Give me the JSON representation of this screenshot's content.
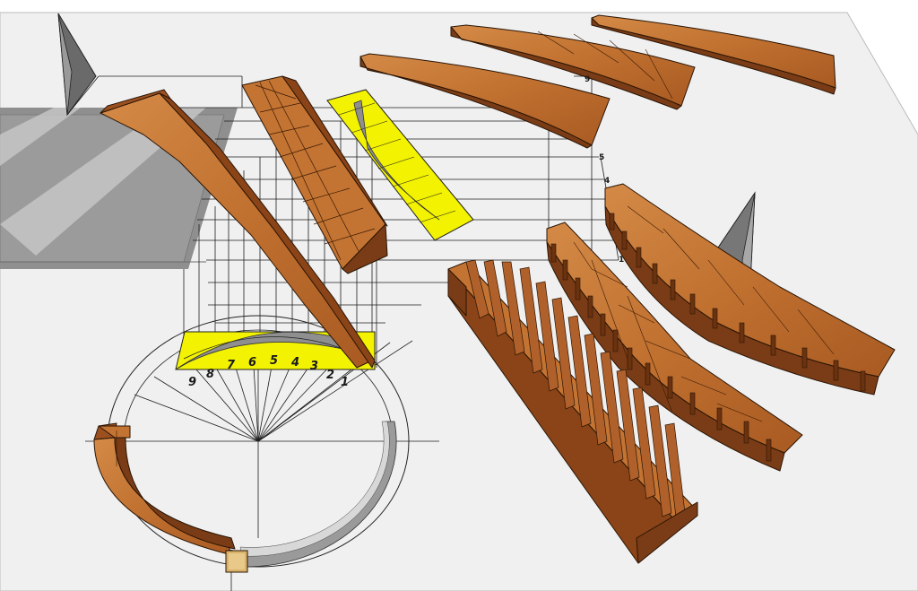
{
  "colors": {
    "background": "#ffffff",
    "ground_plane": "#efefef",
    "shadow_gray": "#8e8e8e",
    "template_yellow": "#f3f200",
    "wood_light": "#c97a3a",
    "wood_mid": "#b0602a",
    "wood_dark": "#7a3c16",
    "line": "#1e1e1e"
  },
  "plan_division_labels": [
    "9",
    "8",
    "7",
    "6",
    "5",
    "4",
    "3",
    "2",
    "1"
  ],
  "rise_marks": [
    "9",
    "5",
    "4",
    "1"
  ],
  "pieces": [
    "rail-elevation-on-plan",
    "rail-blank-block",
    "yellow-face-template",
    "finished-curved-rail-top",
    "finished-curved-rail-middle",
    "finished-curved-rail-bottom",
    "kerfed-rail-flat",
    "kerfed-rail-right",
    "kerfed-blank-combed",
    "half-round-rail-in-plan",
    "end-block"
  ],
  "icons": [
    "plumb-pointer-icon",
    "plumb-pointer-icon-right"
  ]
}
